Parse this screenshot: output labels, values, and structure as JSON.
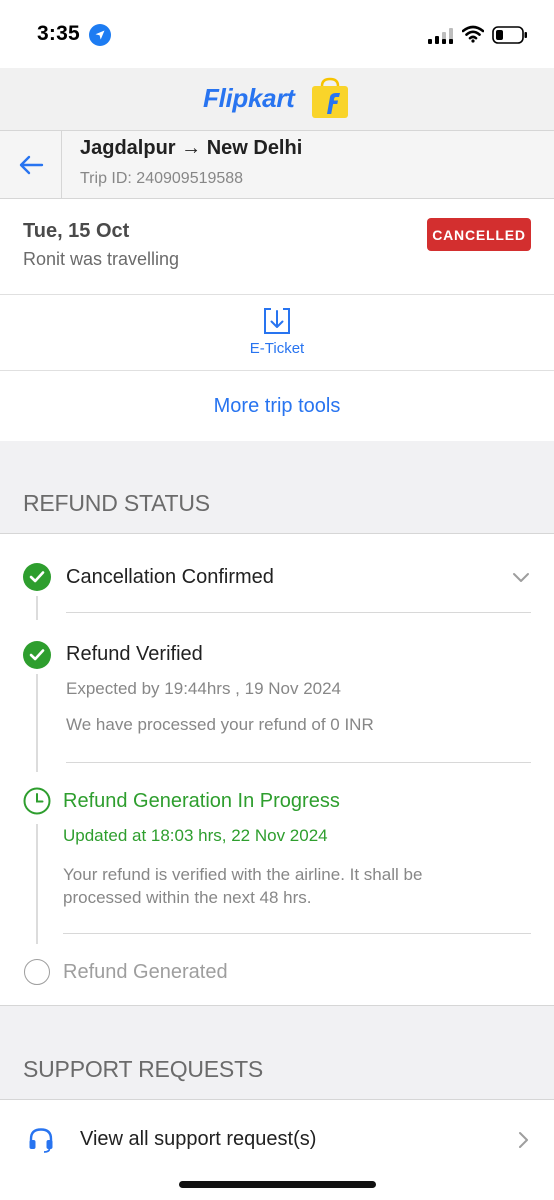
{
  "status_bar": {
    "time": "3:35"
  },
  "brand": {
    "name": "Flipkart"
  },
  "trip": {
    "route": "Jagdalpur → New Delhi",
    "trip_id": "Trip ID: 240909519588",
    "date": "Tue, 15 Oct",
    "traveller": "Ronit was travelling",
    "status_badge": "CANCELLED",
    "badge_color": "#d32f2f"
  },
  "actions": {
    "eticket_label": "E-Ticket",
    "more_tools_label": "More trip tools"
  },
  "refund": {
    "section_title": "REFUND STATUS",
    "steps": [
      {
        "title": "Cancellation Confirmed",
        "state": "done"
      },
      {
        "title": "Refund Verified",
        "state": "done",
        "sub1": "Expected by 19:44hrs , 19 Nov 2024",
        "sub2": "We have processed your refund of 0 INR"
      },
      {
        "title": "Refund Generation In Progress",
        "state": "in-progress",
        "sub1": "Updated at 18:03 hrs, 22 Nov 2024",
        "sub2": "Your refund is verified with the airline. It shall be processed within the next 48 hrs."
      },
      {
        "title": "Refund Generated",
        "state": "pending"
      }
    ]
  },
  "support": {
    "section_title": "SUPPORT REQUESTS",
    "view_all_label": "View all support request(s)"
  },
  "colors": {
    "accent": "#2874f0",
    "success": "#2e9e2e",
    "danger": "#d32f2f"
  },
  "icons": [
    "location-arrow-icon",
    "signal-icon",
    "wifi-icon",
    "battery-icon",
    "shopping-bag-logo-icon",
    "back-arrow-icon",
    "download-ticket-icon",
    "check-icon",
    "clock-icon",
    "chevron-down-icon",
    "headset-icon",
    "chevron-right-icon"
  ]
}
